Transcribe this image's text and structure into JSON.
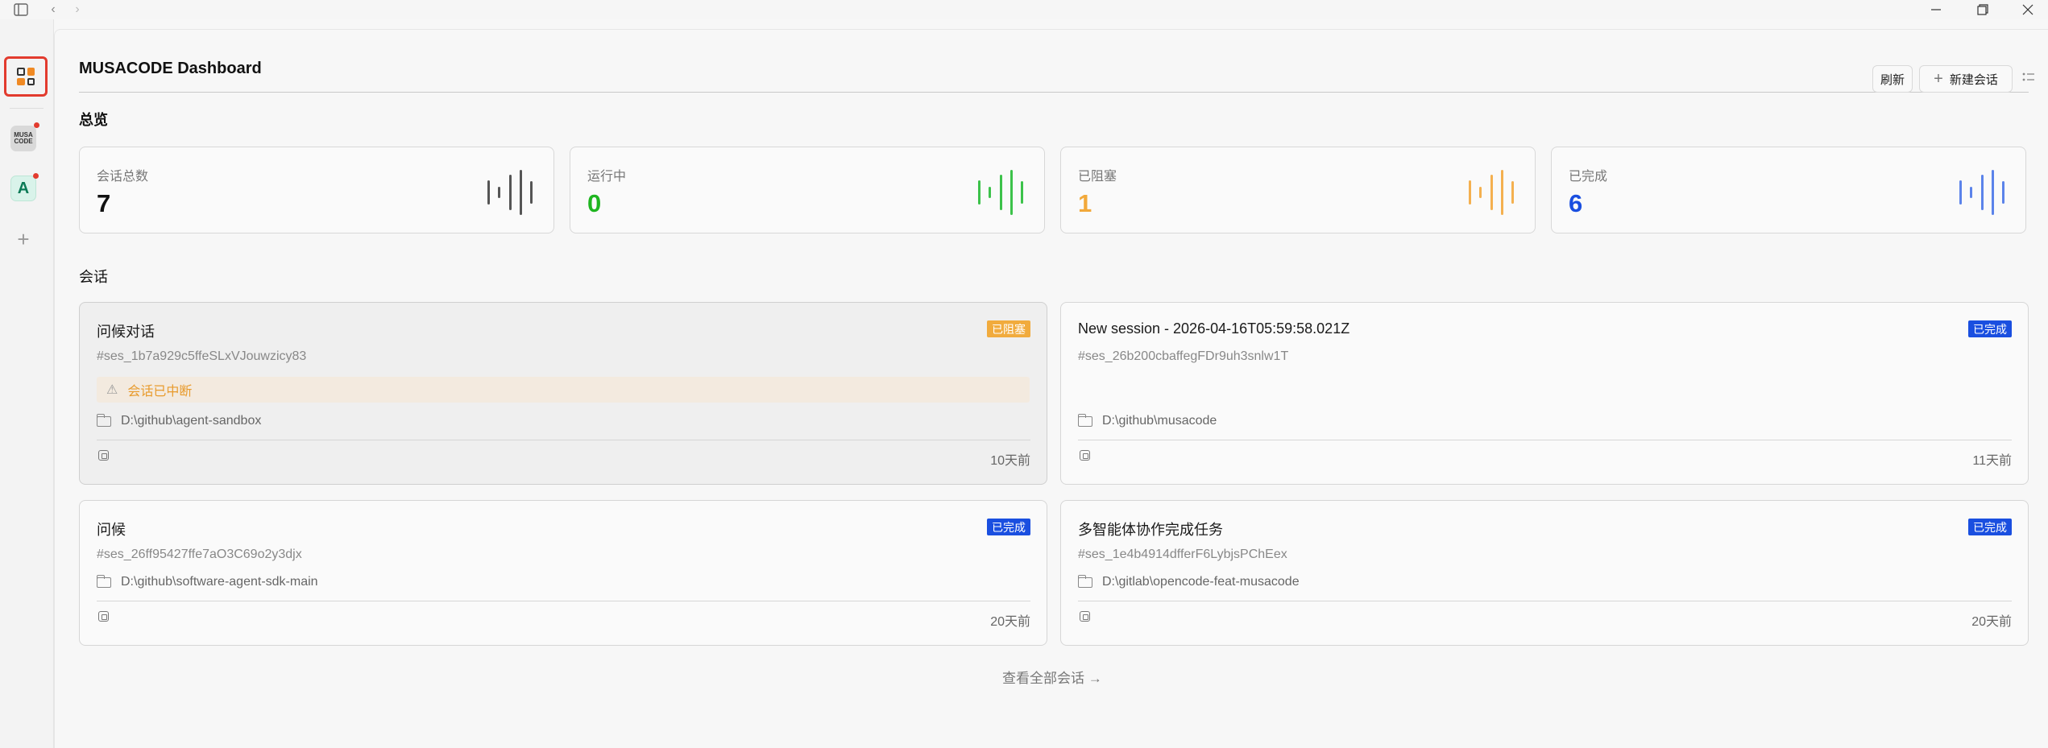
{
  "window": {
    "sidebar_toggle_icon": "sidebar-icon",
    "back_icon": "chevron-left-icon",
    "forward_icon": "chevron-right-icon",
    "minimize_icon": "minimize-icon",
    "maximize_icon": "restore-icon",
    "close_icon": "close-icon"
  },
  "rail": {
    "apps": [
      {
        "name": "MUSACODE",
        "label_lines": [
          "MUSA",
          "CODE"
        ],
        "has_notification": true
      },
      {
        "name": "A",
        "label": "A",
        "has_notification": true
      }
    ]
  },
  "header": {
    "title": "MUSACODE Dashboard",
    "refresh_label": "刷新",
    "new_session_label": "新建会话"
  },
  "overview": {
    "title": "总览",
    "stats": [
      {
        "label": "会话总数",
        "value": "7",
        "color": "#111111",
        "bar_color": "#555555"
      },
      {
        "label": "运行中",
        "value": "0",
        "color": "#1fb520",
        "bar_color": "#3cc24a"
      },
      {
        "label": "已阻塞",
        "value": "1",
        "color": "#f2a93b",
        "bar_color": "#f4b04f"
      },
      {
        "label": "已完成",
        "value": "6",
        "color": "#1a4fe0",
        "bar_color": "#5b83ea"
      }
    ]
  },
  "sessions": {
    "title": "会话",
    "items": [
      {
        "title": "问候对话",
        "id": "#ses_1b7a929c5ffeSLxVJouwzicy83",
        "status": "已阻塞",
        "warning": "会话已中断",
        "path": "D:\\github\\agent-sandbox",
        "time": "10天前"
      },
      {
        "title": "New session - 2026-04-16T05:59:58.021Z",
        "id": "#ses_26b200cbaffegFDr9uh3snlw1T",
        "status": "已完成",
        "path": "D:\\github\\musacode",
        "time": "11天前"
      },
      {
        "title": "问候",
        "id": "#ses_26ff95427ffe7aO3C69o2y3djx",
        "status": "已完成",
        "path": "D:\\github\\software-agent-sdk-main",
        "time": "20天前"
      },
      {
        "title": "多智能体协作完成任务",
        "id": "#ses_1e4b4914dfferF6LybjsPChEex",
        "status": "已完成",
        "path": "D:\\gitlab\\opencode-feat-musacode",
        "time": "20天前"
      }
    ],
    "view_all": "查看全部会话 →"
  }
}
